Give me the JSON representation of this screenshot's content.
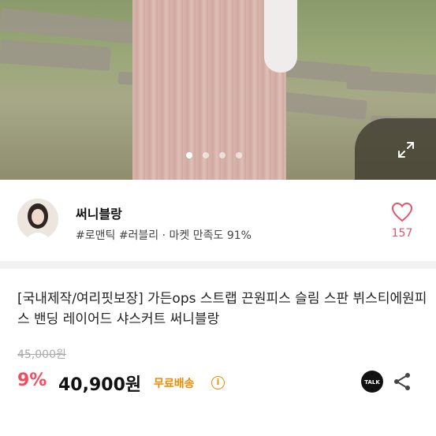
{
  "gallery": {
    "slide_count": 4,
    "active_index": 0
  },
  "seller": {
    "name": "써니블랑",
    "tags": "#로맨틱 #러블리 · 마켓 만족도 91%",
    "like_count": "157"
  },
  "product": {
    "title": "[국내제작/여리핏보장] 가든ops 스트랩 끈원피스 슬림 스판 뷔스티에원피스 밴딩 레이어드 샤스커트 써니블랑",
    "original_price": "45,000원",
    "discount_rate": "9%",
    "sale_price": "40,900원",
    "shipping": "무료배송"
  },
  "colors": {
    "accent_red": "#f24d5e",
    "shipping_orange": "#f08a00",
    "heart_pink": "#e0566a"
  },
  "icons": [
    "expand-icon",
    "heart-icon",
    "info-icon",
    "kakaotalk-icon",
    "share-icon"
  ]
}
